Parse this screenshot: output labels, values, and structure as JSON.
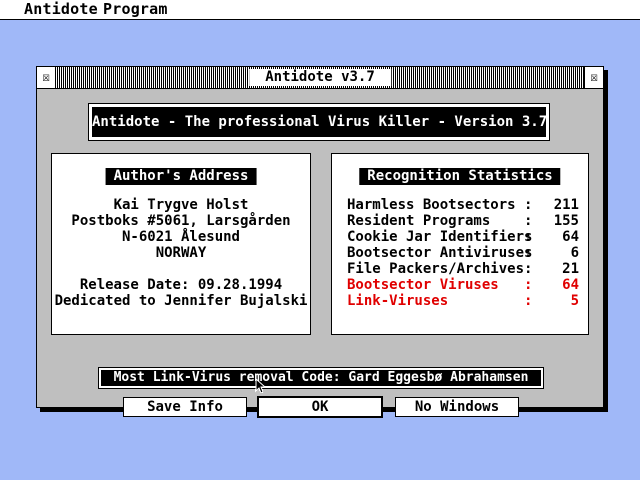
{
  "menubar": {
    "items": [
      "Antidote",
      "Program"
    ]
  },
  "window": {
    "title": "Antidote v3.7",
    "close_glyph": "☒",
    "full_glyph": "☒"
  },
  "banner": "Antidote - The professional Virus Killer - Version 3.7",
  "author": {
    "heading": "Author's Address",
    "lines": [
      "Kai Trygve Holst",
      "Postboks #5061, Larsgården",
      "N-6021 Ålesund",
      "NORWAY"
    ],
    "release": "Release Date: 09.28.1994",
    "dedication": "Dedicated to Jennifer Bujalski"
  },
  "stats": {
    "heading": "Recognition Statistics",
    "rows": [
      {
        "label": "Harmless Bootsectors",
        "value": "211",
        "color": "#000000"
      },
      {
        "label": "Resident Programs",
        "value": "155",
        "color": "#000000"
      },
      {
        "label": "Cookie Jar Identifiers",
        "value": "64",
        "color": "#000000"
      },
      {
        "label": "Bootsector Antiviruses",
        "value": "6",
        "color": "#000000"
      },
      {
        "label": "File Packers/Archives",
        "value": "21",
        "color": "#000000"
      },
      {
        "label": "Bootsector Viruses",
        "value": "64",
        "color": "#e00000"
      },
      {
        "label": "Link-Viruses",
        "value": "5",
        "color": "#e00000"
      }
    ]
  },
  "credit": "Most Link-Virus removal Code: Gard Eggesbø Abrahamsen",
  "buttons": {
    "save": "Save Info",
    "ok": "OK",
    "no_windows": "No Windows"
  },
  "colors": {
    "desktop": "#a0b8f8",
    "alert": "#e00000"
  }
}
